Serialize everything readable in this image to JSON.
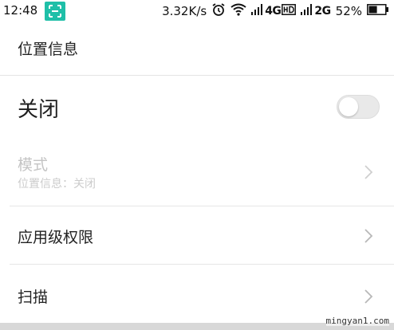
{
  "status_bar": {
    "time": "12:48",
    "net_speed": "3.32K/s",
    "net_type_1": "4G",
    "net_type_2": "2G",
    "battery_percent": "52%",
    "icons": [
      "scan-icon",
      "alarm-icon",
      "wifi-icon",
      "signal-icon",
      "hd-icon",
      "signal-icon",
      "battery-icon"
    ],
    "battery_level": 0.52
  },
  "header": {
    "title": "位置信息"
  },
  "location_toggle": {
    "label": "关闭",
    "state": "off"
  },
  "mode": {
    "label": "模式",
    "subtitle": "位置信息：关闭"
  },
  "app_permissions": {
    "label": "应用级权限"
  },
  "scan": {
    "label": "扫描"
  },
  "watermark": {
    "text": "mingyan1.com"
  },
  "colors": {
    "accent_teal": "#1fbfa8",
    "disabled_text": "#c4c4c4",
    "toggle_off": "#e9e9e9"
  }
}
